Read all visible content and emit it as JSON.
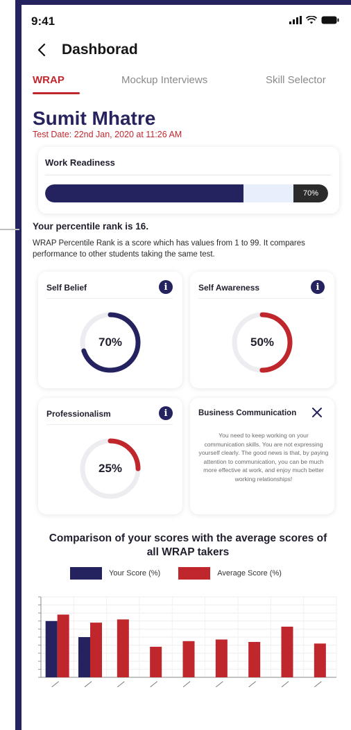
{
  "status_bar": {
    "time": "9:41"
  },
  "header": {
    "title": "Dashborad"
  },
  "tabs": [
    {
      "label": "WRAP",
      "active": true
    },
    {
      "label": "Mockup Interviews",
      "active": false
    },
    {
      "label": "Skill Selector",
      "active": false
    }
  ],
  "profile": {
    "name": "Sumit Mhatre",
    "test_date": "Test Date: 22nd Jan, 2020 at 11:26 AM"
  },
  "work_readiness": {
    "title": "Work Readiness",
    "value": 70,
    "value_label": "70%"
  },
  "percentile": {
    "rank_text": "Your percentile rank is 16.",
    "description": "WRAP Percentile Rank is a score which has values from 1 to 99. It compares performance to other students taking the same test."
  },
  "score_cards": [
    {
      "title": "Self Belief",
      "value": 70,
      "label": "70%",
      "ring_color": "#25235f",
      "info_icon": "info-icon"
    },
    {
      "title": "Self Awareness",
      "value": 50,
      "label": "50%",
      "ring_color": "#c0272d",
      "info_icon": "info-icon"
    },
    {
      "title": "Professionalism",
      "value": 25,
      "label": "25%",
      "ring_color": "#c0272d",
      "info_icon": "info-icon"
    }
  ],
  "business_communication": {
    "title": "Business Communication",
    "text": "You need to keep working on your communication skills. You are not expressing yourself clearly. The good news is that, by paying attention to communication, you can be much more effective at work, and enjoy much better working relationships!"
  },
  "comparison": {
    "title": "Comparison of your scores with the average scores of all WRAP takers",
    "legend": [
      {
        "label": "Your Score (%)",
        "color": "#25235f"
      },
      {
        "label": "Average Score (%)",
        "color": "#c0272d"
      }
    ]
  },
  "chart_data": {
    "type": "bar",
    "categories": [
      "",
      "",
      "",
      "",
      "",
      "",
      "",
      "",
      ""
    ],
    "series": [
      {
        "name": "Your Score (%)",
        "values": [
          70,
          50,
          null,
          null,
          null,
          null,
          null,
          null,
          null
        ],
        "color": "#25235f"
      },
      {
        "name": "Average Score (%)",
        "values": [
          78,
          68,
          72,
          38,
          45,
          47,
          44,
          63,
          42
        ],
        "color": "#c0272d"
      }
    ],
    "ylim": [
      0,
      100
    ],
    "grid": true
  },
  "colors": {
    "primary": "#25235f",
    "accent": "#c0272d"
  }
}
